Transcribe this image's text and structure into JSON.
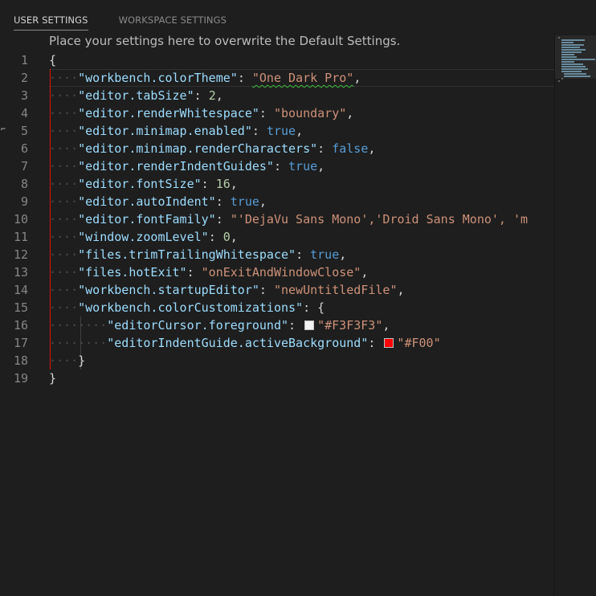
{
  "tabs": [
    {
      "label": "USER SETTINGS",
      "active": true
    },
    {
      "label": "WORKSPACE SETTINGS",
      "active": false
    }
  ],
  "hint": "Place your settings here to overwrite the Default Settings.",
  "colors": {
    "background": "#1e1e1e",
    "key": "#9cdcfe",
    "string": "#ce9178",
    "number": "#b5cea8",
    "keyword": "#569cd6",
    "active_indent_guide": "#e51400"
  },
  "lines": [
    {
      "n": "1",
      "open": "{"
    },
    {
      "n": "2",
      "ws": "····",
      "key": "\"workbench.colorTheme\"",
      "sep": ": ",
      "str": "\"One Dark Pro\"",
      "end": ","
    },
    {
      "n": "3",
      "ws": "····",
      "key": "\"editor.tabSize\"",
      "sep": ": ",
      "num": "2",
      "end": ","
    },
    {
      "n": "4",
      "ws": "····",
      "key": "\"editor.renderWhitespace\"",
      "sep": ": ",
      "str": "\"boundary\"",
      "end": ","
    },
    {
      "n": "5",
      "ws": "····",
      "key": "\"editor.minimap.enabled\"",
      "sep": ": ",
      "kw": "true",
      "end": ","
    },
    {
      "n": "6",
      "ws": "····",
      "key": "\"editor.minimap.renderCharacters\"",
      "sep": ": ",
      "kw": "false",
      "end": ","
    },
    {
      "n": "7",
      "ws": "····",
      "key": "\"editor.renderIndentGuides\"",
      "sep": ": ",
      "kw": "true",
      "end": ","
    },
    {
      "n": "8",
      "ws": "····",
      "key": "\"editor.fontSize\"",
      "sep": ": ",
      "num": "16",
      "end": ","
    },
    {
      "n": "9",
      "ws": "····",
      "key": "\"editor.autoIndent\"",
      "sep": ": ",
      "kw": "true",
      "end": ","
    },
    {
      "n": "10",
      "ws": "····",
      "key": "\"editor.fontFamily\"",
      "sep": ": ",
      "str": "\"'DejaVu Sans Mono','Droid Sans Mono', 'm",
      "end": ""
    },
    {
      "n": "11",
      "ws": "····",
      "key": "\"window.zoomLevel\"",
      "sep": ": ",
      "num": "0",
      "end": ","
    },
    {
      "n": "12",
      "ws": "····",
      "key": "\"files.trimTrailingWhitespace\"",
      "sep": ": ",
      "kw": "true",
      "end": ","
    },
    {
      "n": "13",
      "ws": "····",
      "key": "\"files.hotExit\"",
      "sep": ": ",
      "str": "\"onExitAndWindowClose\"",
      "end": ","
    },
    {
      "n": "14",
      "ws": "····",
      "key": "\"workbench.startupEditor\"",
      "sep": ": ",
      "str": "\"newUntitledFile\"",
      "end": ","
    },
    {
      "n": "15",
      "ws": "····",
      "key": "\"workbench.colorCustomizations\"",
      "sep": ": ",
      "end": "{"
    },
    {
      "n": "16",
      "ws": "········",
      "key": "\"editorCursor.foreground\"",
      "sep": ": ",
      "swatch": "#F3F3F3",
      "str": "\"#F3F3F3\"",
      "end": ","
    },
    {
      "n": "17",
      "ws": "········",
      "key": "\"editorIndentGuide.activeBackground\"",
      "sep": ": ",
      "swatch": "#FF0000",
      "str": "\"#F00\"",
      "end": ""
    },
    {
      "n": "18",
      "ws": "····",
      "close": "}"
    },
    {
      "n": "19",
      "close": "}"
    }
  ]
}
